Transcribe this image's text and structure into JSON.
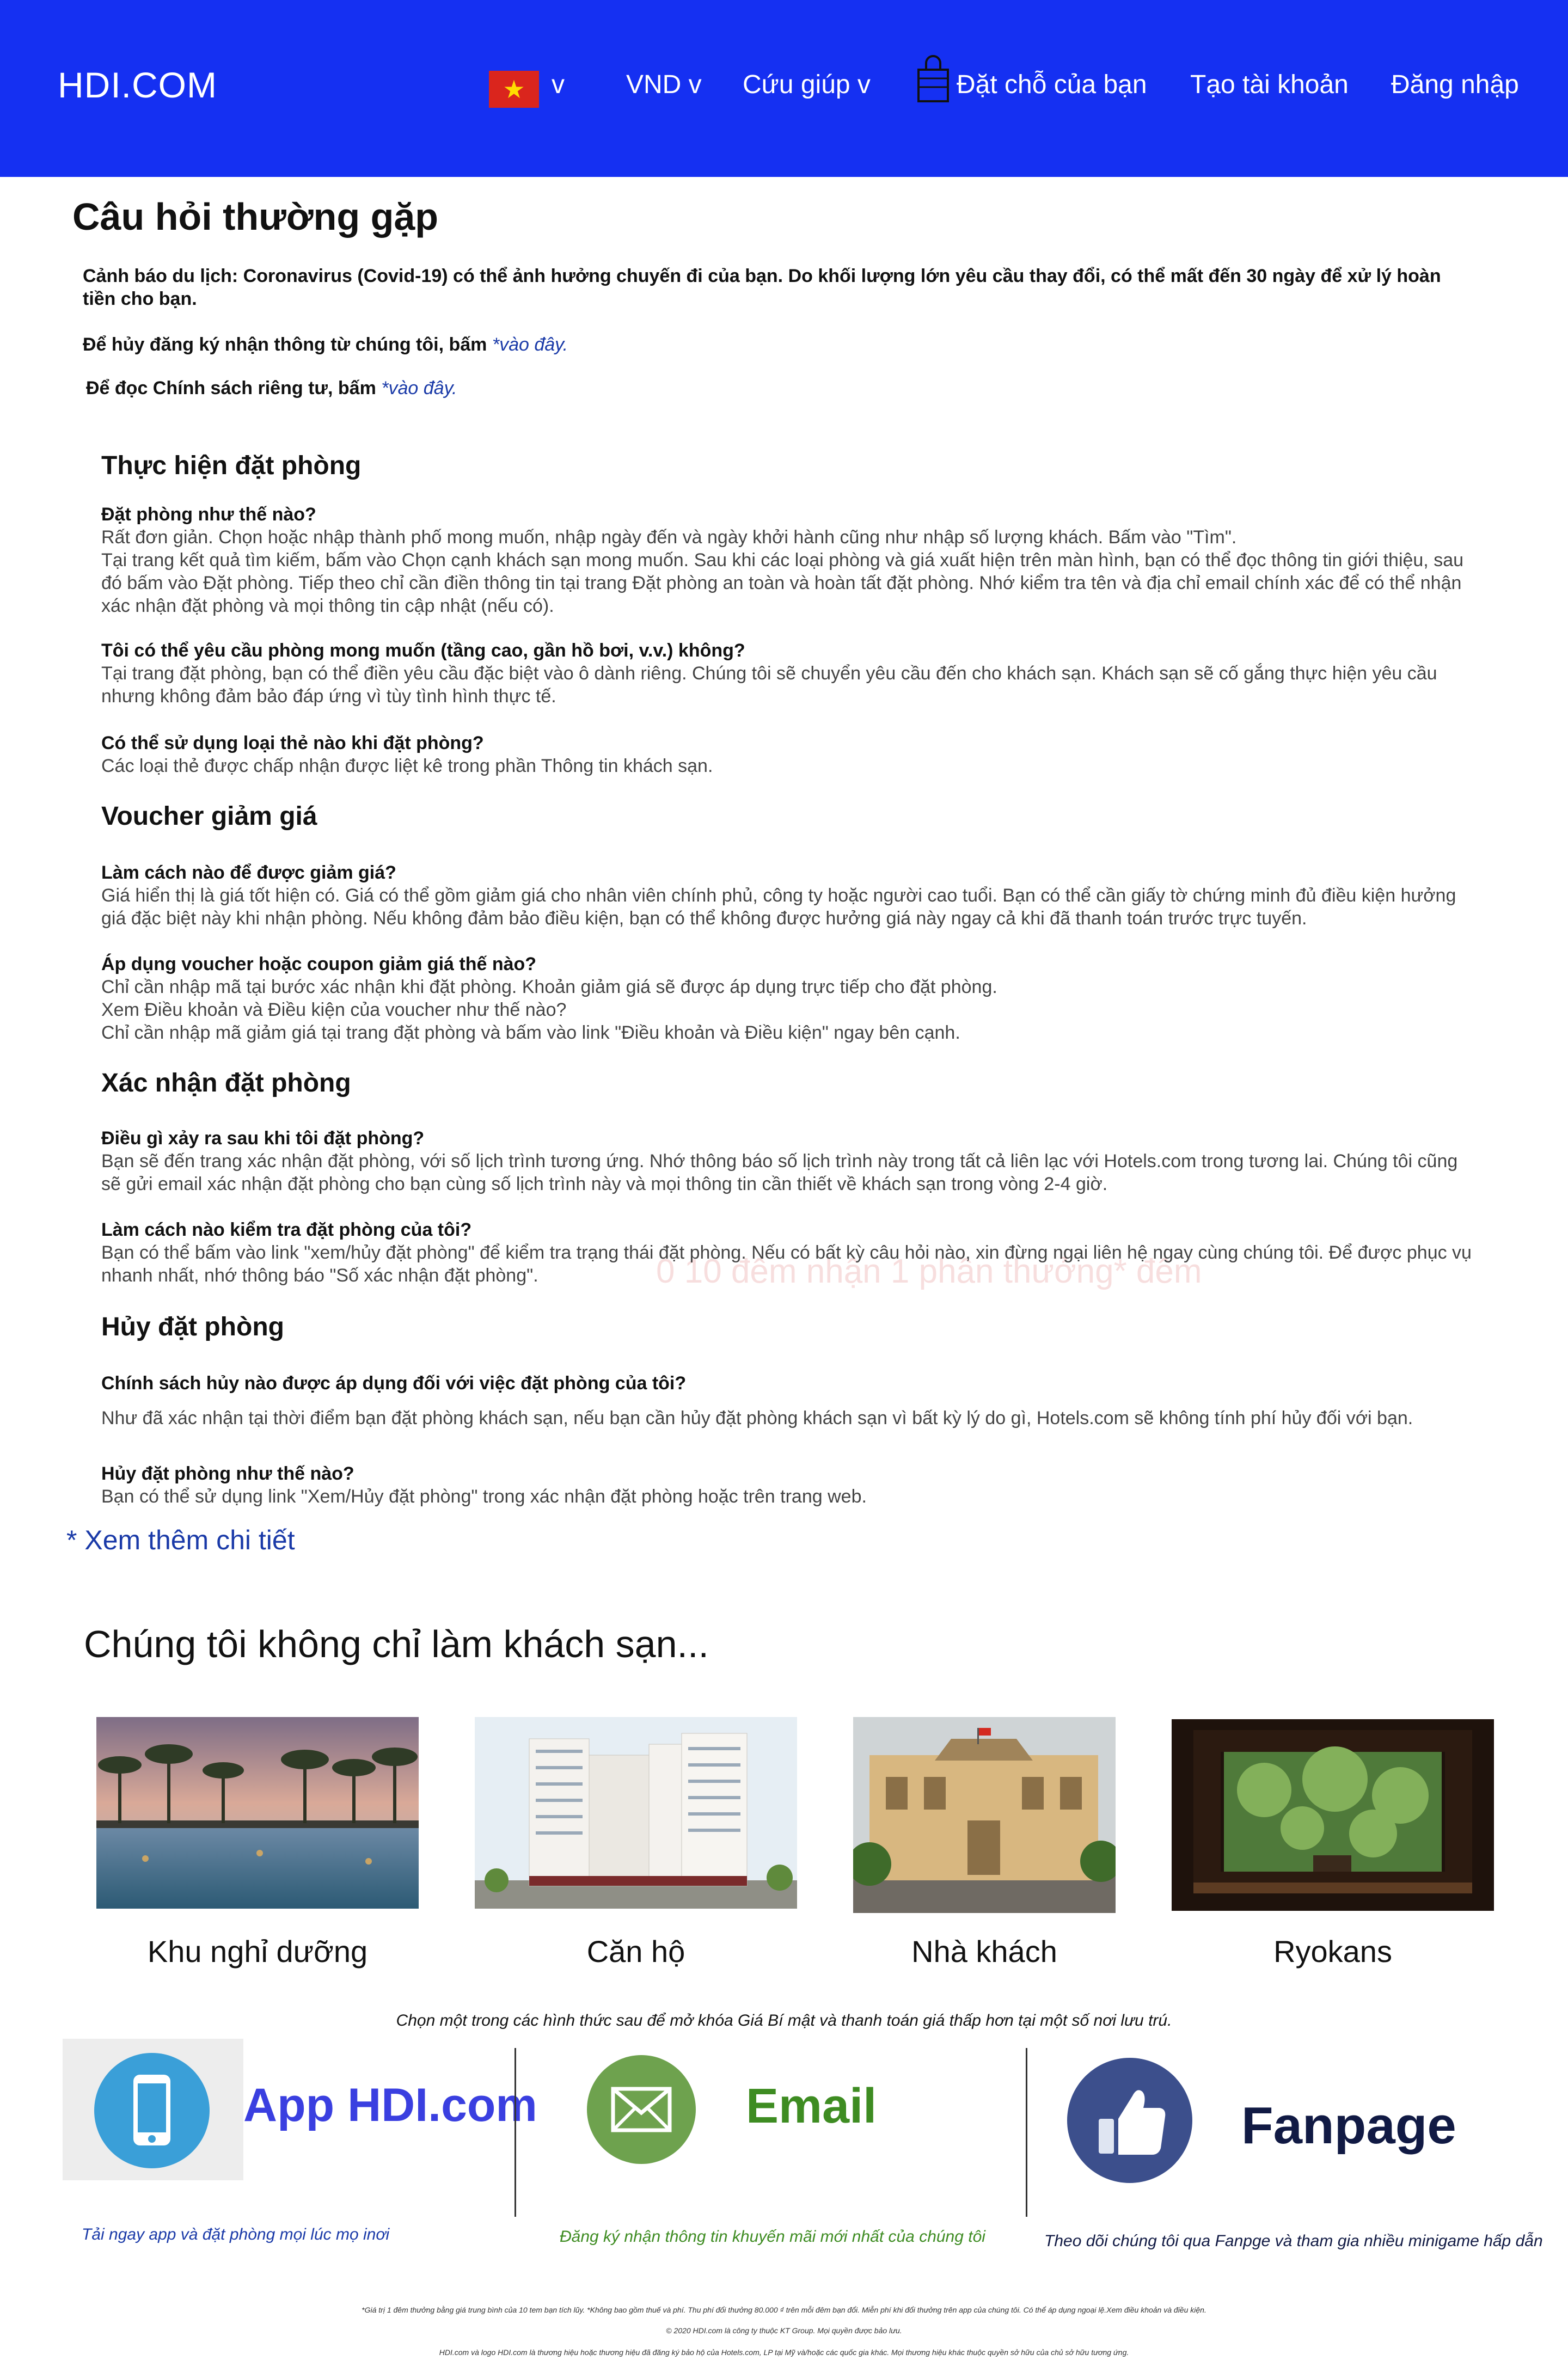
{
  "header": {
    "logo": "HDI.COM",
    "language_caret": "v",
    "currency": "VND v",
    "help": "Cứu giúp v",
    "bookings": "Đặt chỗ của bạn",
    "create_account": "Tạo tài khoản",
    "login": "Đăng nhập"
  },
  "faq": {
    "title": "Câu hỏi thường gặp",
    "warning": "Cảnh báo du lịch: Coronavirus (Covid-19) có thể ảnh hưởng chuyến đi của bạn. Do khối lượng lớn yêu cầu thay đổi, có thể mất đến 30 ngày để xử lý hoàn tiền cho bạn.",
    "unsubscribe_text": "Để hủy đăng ký nhận thông từ chúng tôi, bấm ",
    "unsubscribe_link": "*vào đây.",
    "privacy_text": "Để đọc Chính sách riêng tư, bấm ",
    "privacy_link": "*vào đây.",
    "sections": [
      {
        "title": "Thực hiện đặt phòng",
        "items": [
          {
            "q": "Đặt phòng như thế nào?",
            "a": [
              "Rất đơn giản. Chọn hoặc nhập thành phố mong muốn, nhập ngày đến và ngày khởi hành cũng như nhập số lượng khách. Bấm vào \"Tìm\".",
              "Tại trang kết quả tìm kiếm, bấm vào Chọn cạnh khách sạn mong muốn. Sau khi các loại phòng và giá xuất hiện trên màn hình, bạn có thể đọc thông tin giới thiệu, sau đó bấm vào Đặt phòng. Tiếp theo chỉ cần điền thông tin tại trang Đặt phòng an toàn và hoàn tất đặt phòng. Nhớ kiểm tra tên và địa chỉ email chính xác để có thể nhận xác nhận đặt phòng và mọi thông tin cập nhật (nếu có)."
            ]
          },
          {
            "q": "Tôi có thể yêu cầu phòng mong muốn (tầng cao, gần hồ bơi, v.v.) không?",
            "a": [
              "Tại trang đặt phòng, bạn có thể điền yêu cầu đặc biệt vào ô dành riêng. Chúng tôi sẽ chuyển yêu cầu đến cho khách sạn. Khách sạn sẽ cố gắng thực hiện yêu cầu nhưng không đảm bảo đáp ứng vì tùy tình hình thực tế."
            ]
          },
          {
            "q": "Có thể sử dụng loại thẻ nào khi đặt phòng?",
            "a": [
              "Các loại thẻ được chấp nhận được liệt kê trong phần Thông tin khách sạn."
            ]
          }
        ]
      },
      {
        "title": "Voucher giảm giá",
        "items": [
          {
            "q": "Làm cách nào để được giảm giá?",
            "a": [
              "Giá hiển thị là giá tốt hiện có. Giá có thể gồm giảm giá cho nhân viên chính phủ, công ty hoặc người cao tuổi. Bạn có thể cần giấy tờ chứng minh đủ điều kiện hưởng giá đặc biệt này khi nhận phòng. Nếu không đảm bảo điều kiện, bạn có thể không được hưởng giá này ngay cả khi đã thanh toán trước trực tuyến."
            ]
          },
          {
            "q": "Áp dụng voucher hoặc coupon giảm giá thế nào?",
            "a": [
              "Chỉ cần nhập mã tại bước xác nhận khi đặt phòng. Khoản giảm giá sẽ được áp dụng trực tiếp cho đặt phòng.",
              "Xem Điều khoản và Điều kiện của voucher như thế nào?",
              "Chỉ cần nhập mã giảm giá tại trang đặt phòng và bấm vào link \"Điều khoản và Điều kiện\" ngay bên cạnh."
            ]
          }
        ]
      },
      {
        "title": "Xác nhận đặt phòng",
        "items": [
          {
            "q": "Điều gì xảy ra sau khi tôi đặt phòng?",
            "a": [
              "Bạn sẽ đến trang xác nhận đặt phòng, với số lịch trình tương ứng. Nhớ thông báo số lịch trình này trong tất cả liên lạc với Hotels.com trong tương lai. Chúng tôi cũng sẽ gửi email xác nhận đặt phòng cho bạn cùng số lịch trình này và mọi thông tin cần thiết về khách sạn trong vòng 2-4 giờ."
            ]
          },
          {
            "q": "Làm cách nào kiểm tra đặt phòng của tôi?",
            "a": [
              "Bạn có thể bấm vào link \"xem/hủy đặt phòng\" để kiểm tra trạng thái đặt phòng. Nếu có bất kỳ câu hỏi nào, xin đừng ngại liên hệ ngay cùng chúng tôi. Để được phục vụ nhanh nhất, nhớ thông báo \"Số xác nhận đặt phòng\"."
            ]
          }
        ]
      },
      {
        "title": "Hủy đặt phòng",
        "items": [
          {
            "q": "Chính sách hủy nào được áp dụng đối với việc đặt phòng của tôi?",
            "a": [
              "",
              "Như đã xác nhận tại thời điểm bạn đặt phòng khách sạn, nếu bạn cần hủy đặt phòng khách sạn vì bất kỳ lý do gì, Hotels.com sẽ không tính phí hủy đối với bạn."
            ]
          },
          {
            "q": "Hủy đặt phòng như thế nào?",
            "a": [
              "Bạn có thể sử dụng link \"Xem/Hủy đặt phòng\" trong xác nhận đặt phòng hoặc trên trang web."
            ]
          }
        ]
      }
    ],
    "watermark": "0 10 đêm nhận 1 phần thưởng* đêm",
    "more": "* Xem thêm chi tiết"
  },
  "hotel_types": {
    "title": "Chúng tôi không chỉ làm khách sạn...",
    "items": [
      {
        "label": "Khu nghỉ dưỡng"
      },
      {
        "label": "Căn hộ"
      },
      {
        "label": "Nhà khách"
      },
      {
        "label": "Ryokans"
      }
    ]
  },
  "promo": {
    "note": "Chọn một trong các hình thức sau để mở khóa Giá Bí mật và thanh toán giá thấp hơn tại một số nơi lưu trú.",
    "app": {
      "title": "App HDI.com",
      "caption": "Tải ngay app và đặt phòng mọi lúc mọ inơi",
      "color": "#3a3fe0"
    },
    "email": {
      "title": "Email",
      "caption": "Đăng ký nhận thông tin khuyến mãi mới nhất của chúng tôi",
      "color": "#3e8c22"
    },
    "fanpage": {
      "title": "Fanpage",
      "caption": "Theo dõi chúng tôi qua Fanpge và tham gia nhiều minigame hấp dẫn",
      "color": "#111a44"
    }
  },
  "footer": {
    "line1": "*Giá trị 1 đêm thưởng bằng giá trung bình của 10 tem bạn tích lũy. *Không bao gồm thuế và phí. Thu phí đổi thưởng 80.000 ₫ trên mỗi đêm bạn đổi. Miễn phí khi đổi thưởng trên app của chúng tôi. Có thể áp dụng ngoại lệ.Xem điều khoản và điều kiện.",
    "line2": "© 2020 HDI.com là công ty thuộc KT Group. Mọi quyền được bảo lưu.",
    "line3": "HDI.com và logo HDI.com là thương hiệu hoặc thương hiệu đã đăng ký bảo hộ của Hotels.com, LP tại Mỹ và/hoặc các quốc gia khác. Mọi thương hiệu khác thuộc quyền sở hữu của chủ sở hữu tương ứng."
  },
  "colors": {
    "header_bg": "#1530f2",
    "link": "#1a3aa8"
  }
}
